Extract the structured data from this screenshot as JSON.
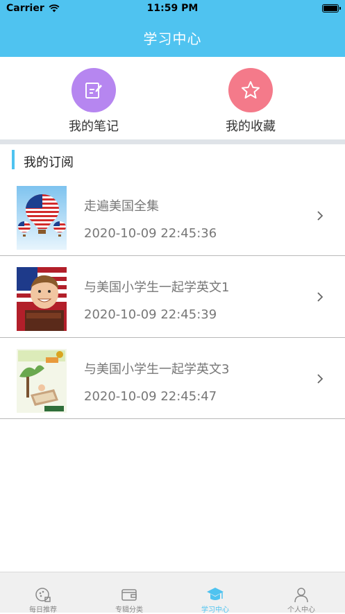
{
  "status_bar": {
    "carrier": "Carrier",
    "time": "11:59 PM",
    "battery_level": 1.0
  },
  "header": {
    "title": "学习中心"
  },
  "shortcuts": [
    {
      "label": "我的笔记",
      "icon": "note-edit-icon",
      "color": "#b686f0"
    },
    {
      "label": "我的收藏",
      "icon": "star-icon",
      "color": "#f47a8a"
    }
  ],
  "section": {
    "title": "我的订阅",
    "accent": "#4fc3f0"
  },
  "subscriptions": [
    {
      "title": "走遍美国全集",
      "date": "2020-10-09 22:45:36",
      "thumbnail": "hot-air-balloons-image"
    },
    {
      "title": "与美国小学生一起学英文1",
      "date": "2020-10-09 22:45:39",
      "thumbnail": "boy-with-flag-image"
    },
    {
      "title": "与美国小学生一起学英文3",
      "date": "2020-10-09 22:45:47",
      "thumbnail": "book-cover-image"
    }
  ],
  "tabbar": {
    "active_index": 2,
    "tabs": [
      {
        "label": "每日推荐",
        "icon": "recommend-icon"
      },
      {
        "label": "专辑分类",
        "icon": "wallet-icon"
      },
      {
        "label": "学习中心",
        "icon": "graduation-cap-icon"
      },
      {
        "label": "个人中心",
        "icon": "person-icon"
      }
    ]
  }
}
